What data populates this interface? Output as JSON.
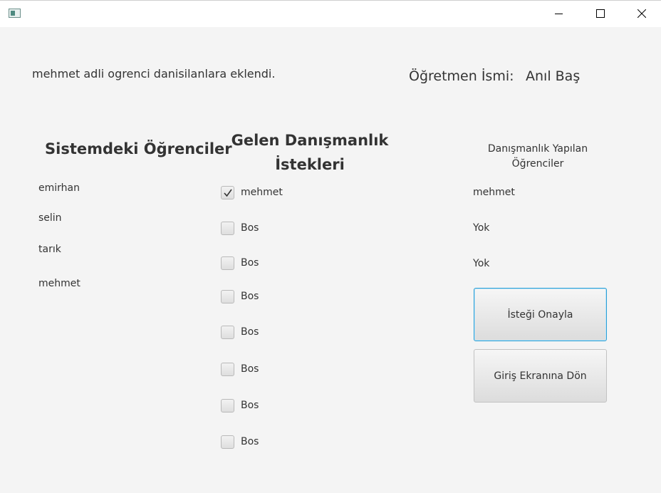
{
  "status_message": "mehmet adli ogrenci danisilanlara eklendi.",
  "teacher": {
    "label": "Öğretmen İsmi:",
    "name": "Anıl Baş"
  },
  "students_panel": {
    "title": "Sistemdeki Öğrenciler",
    "items": [
      "emirhan",
      "selin",
      "tarık",
      "mehmet"
    ]
  },
  "requests_panel": {
    "title_line1": "Gelen Danışmanlık",
    "title_line2": "İstekleri",
    "items": [
      {
        "label": "mehmet",
        "checked": true
      },
      {
        "label": "Bos",
        "checked": false
      },
      {
        "label": "Bos",
        "checked": false
      },
      {
        "label": "Bos",
        "checked": false
      },
      {
        "label": "Bos",
        "checked": false
      },
      {
        "label": "Bos",
        "checked": false
      },
      {
        "label": "Bos",
        "checked": false
      },
      {
        "label": "Bos",
        "checked": false
      }
    ]
  },
  "advised_panel": {
    "title_line1": "Danışmanlık Yapılan",
    "title_line2": "Öğrenciler",
    "items": [
      "mehmet",
      "Yok",
      "Yok"
    ]
  },
  "buttons": {
    "approve": "İsteği Onayla",
    "back": "Giriş Ekranına Dön"
  },
  "colors": {
    "background": "#f4f4f4",
    "focus_border": "#2a9fd6",
    "text": "#333333"
  }
}
